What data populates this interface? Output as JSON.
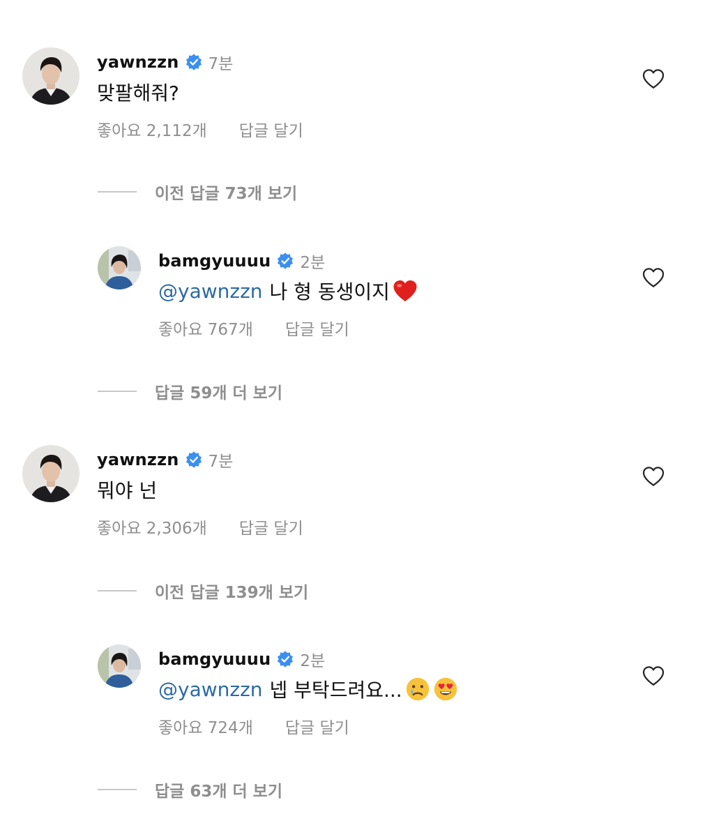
{
  "threads": [
    {
      "comment": {
        "username": "yawnzzn",
        "time": "7분",
        "text": "맞팔해줘?",
        "likes": "좋아요 2,112개",
        "reply_label": "답글 달기",
        "avatar_icon": "avatar-photo-icon"
      },
      "view_previous": "이전 답글 73개 보기",
      "reply": {
        "username": "bamgyuuuu",
        "time": "2분",
        "mention": "@yawnzzn",
        "text": "나 형 동생이지",
        "emoji": "red-heart-emoji",
        "likes": "좋아요 767개",
        "reply_label": "답글 달기"
      },
      "view_more": "답글 59개 더 보기"
    },
    {
      "comment": {
        "username": "yawnzzn",
        "time": "7분",
        "text": "뭐야 넌",
        "likes": "좋아요 2,306개",
        "reply_label": "답글 달기",
        "avatar_icon": "avatar-photo-icon"
      },
      "view_previous": "이전 답글 139개 보기",
      "reply": {
        "username": "bamgyuuuu",
        "time": "2분",
        "mention": "@yawnzzn",
        "text": "넵 부탁드려요...",
        "emoji": "crying-face-emoji, heart-eyes-emoji",
        "likes": "좋아요 724개",
        "reply_label": "답글 달기"
      },
      "view_more": "답글 63개 더 보기"
    }
  ],
  "colors": {
    "mention": "#2b6aa3",
    "verified": "#3b8ff0",
    "muted": "#8e8e8e"
  }
}
